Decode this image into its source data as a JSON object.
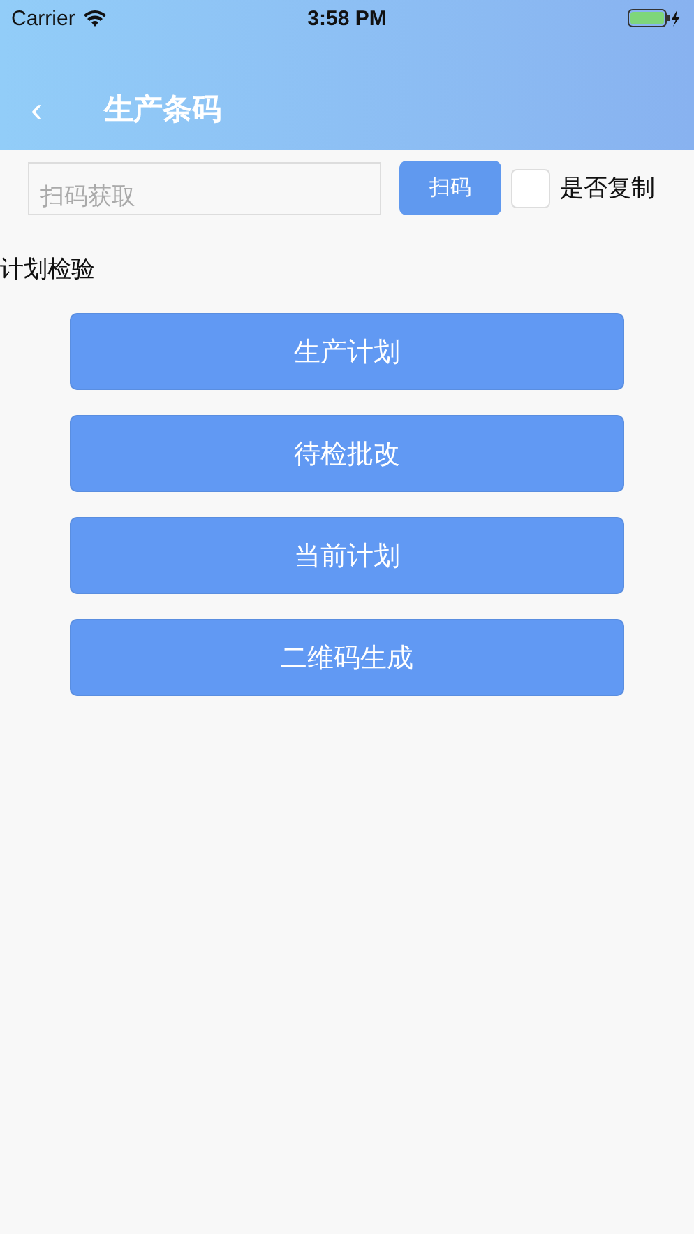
{
  "status_bar": {
    "carrier": "Carrier",
    "time": "3:58 PM"
  },
  "nav": {
    "back": "‹",
    "title": "生产条码"
  },
  "scan": {
    "placeholder": "扫码获取",
    "button": "扫码",
    "copy": {
      "label": "是否复制",
      "checked": false
    }
  },
  "section": "计划检验",
  "buttons": [
    "生产计划",
    "待检批改",
    "当前计划",
    "二维码生成"
  ]
}
